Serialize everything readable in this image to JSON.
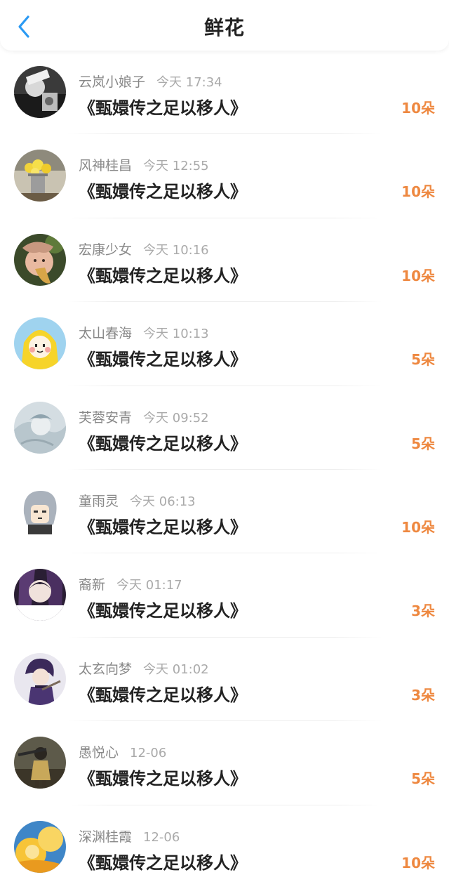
{
  "header": {
    "title": "鲜花",
    "back_icon": "chevron-left-icon",
    "accent_color": "#2b9af3"
  },
  "colors": {
    "flower_count": "#ee8840",
    "name_text": "#888888",
    "time_text": "#aaaaaa",
    "title_text": "#222222"
  },
  "items": [
    {
      "name": "云岚小娘子",
      "time": "今天 17:34",
      "title": "《甄嬛传之足以移人》",
      "count": "10朵"
    },
    {
      "name": "风神桂昌",
      "time": "今天 12:55",
      "title": "《甄嬛传之足以移人》",
      "count": "10朵"
    },
    {
      "name": "宏康少女",
      "time": "今天 10:16",
      "title": "《甄嬛传之足以移人》",
      "count": "10朵"
    },
    {
      "name": "太山春海",
      "time": "今天 10:13",
      "title": "《甄嬛传之足以移人》",
      "count": "5朵"
    },
    {
      "name": "芙蓉安青",
      "time": "今天 09:52",
      "title": "《甄嬛传之足以移人》",
      "count": "5朵"
    },
    {
      "name": "童雨灵",
      "time": "今天 06:13",
      "title": "《甄嬛传之足以移人》",
      "count": "10朵"
    },
    {
      "name": "裔新",
      "time": "今天 01:17",
      "title": "《甄嬛传之足以移人》",
      "count": "3朵"
    },
    {
      "name": "太玄向梦",
      "time": "今天 01:02",
      "title": "《甄嬛传之足以移人》",
      "count": "3朵"
    },
    {
      "name": "愚悦心",
      "time": "12-06",
      "title": "《甄嬛传之足以移人》",
      "count": "5朵"
    },
    {
      "name": "深渊桂霞",
      "time": "12-06",
      "title": "《甄嬛传之足以移人》",
      "count": "10朵"
    }
  ]
}
